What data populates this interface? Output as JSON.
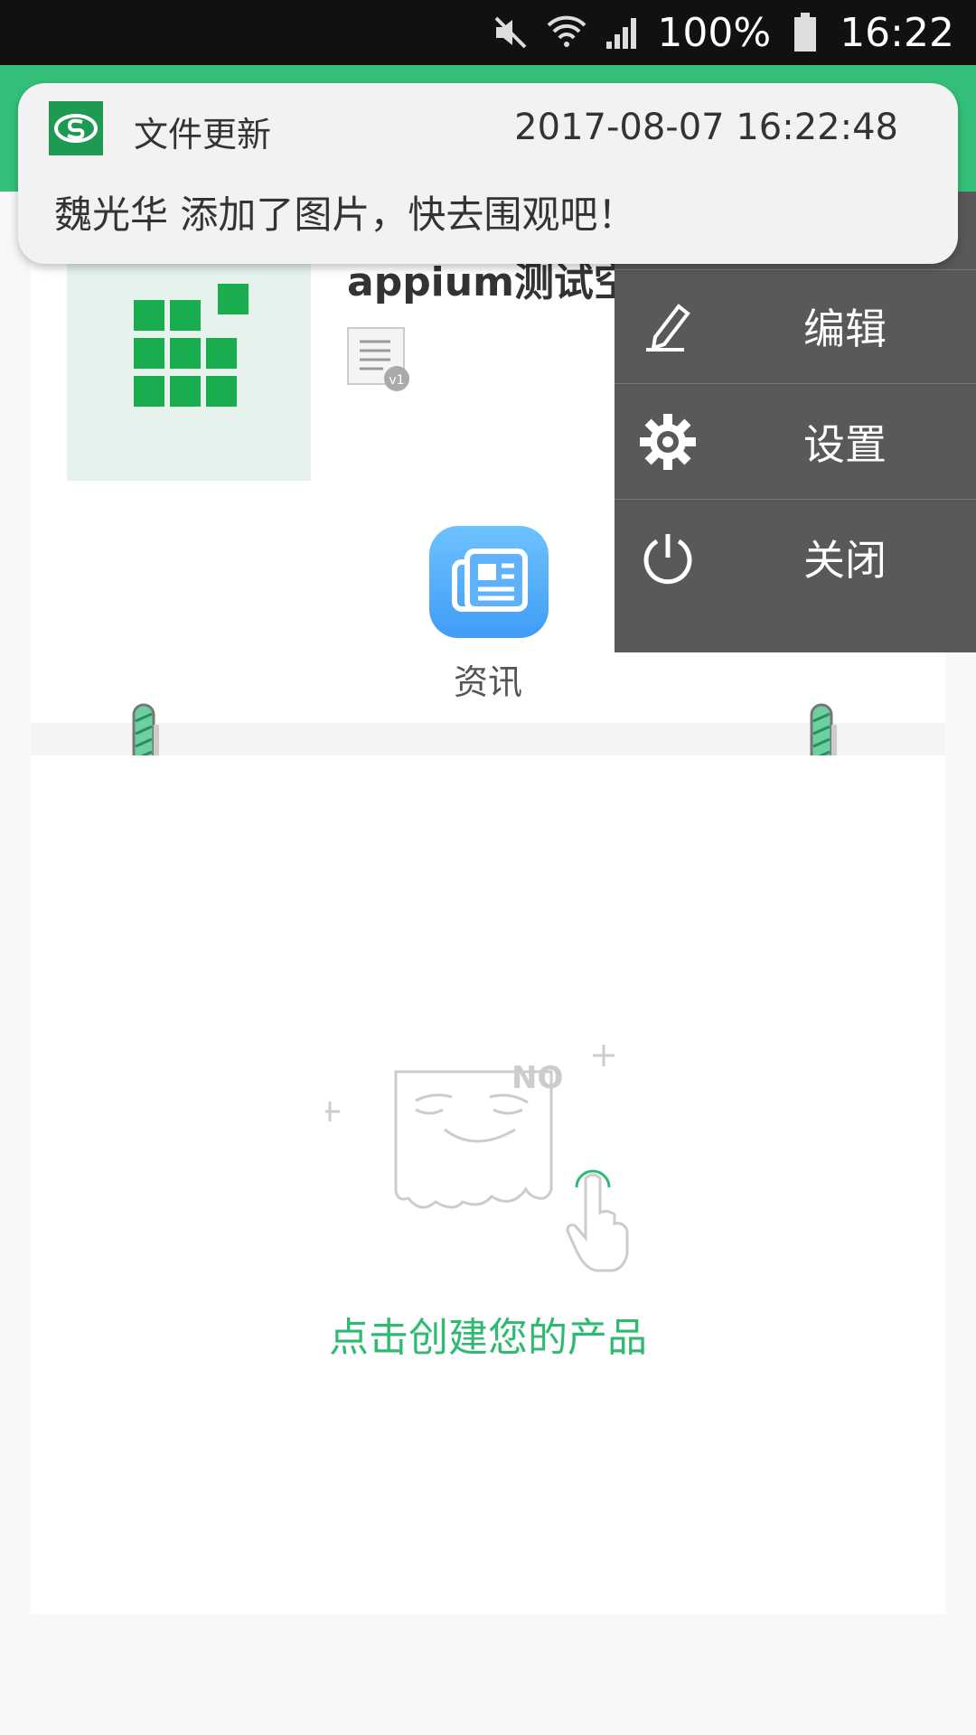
{
  "status_bar": {
    "battery_text": "100%",
    "time": "16:22",
    "icons": [
      "mute-icon",
      "wifi-icon",
      "signal-icon",
      "battery-icon"
    ]
  },
  "notification": {
    "app_name": "文件更新",
    "time": "2017-08-07 16:22:48",
    "message": "魏光华 添加了图片，快去围观吧！",
    "icon": "app-logo-icon"
  },
  "project": {
    "name": "appium测试空",
    "version_badge": "v1"
  },
  "shortcut": {
    "label": "资讯",
    "icon": "news-icon"
  },
  "menu": {
    "items": [
      {
        "label": "",
        "icon": "top-partial-icon"
      },
      {
        "label": "编辑",
        "icon": "pencil-icon"
      },
      {
        "label": "设置",
        "icon": "gear-icon"
      },
      {
        "label": "关闭",
        "icon": "power-icon"
      }
    ]
  },
  "empty_state": {
    "badge": "NO",
    "text": "点击创建您的产品"
  },
  "colors": {
    "accent": "#34c07a",
    "menu_bg": "#595959",
    "empty_text": "#2fba72",
    "status_bg": "#111111"
  }
}
